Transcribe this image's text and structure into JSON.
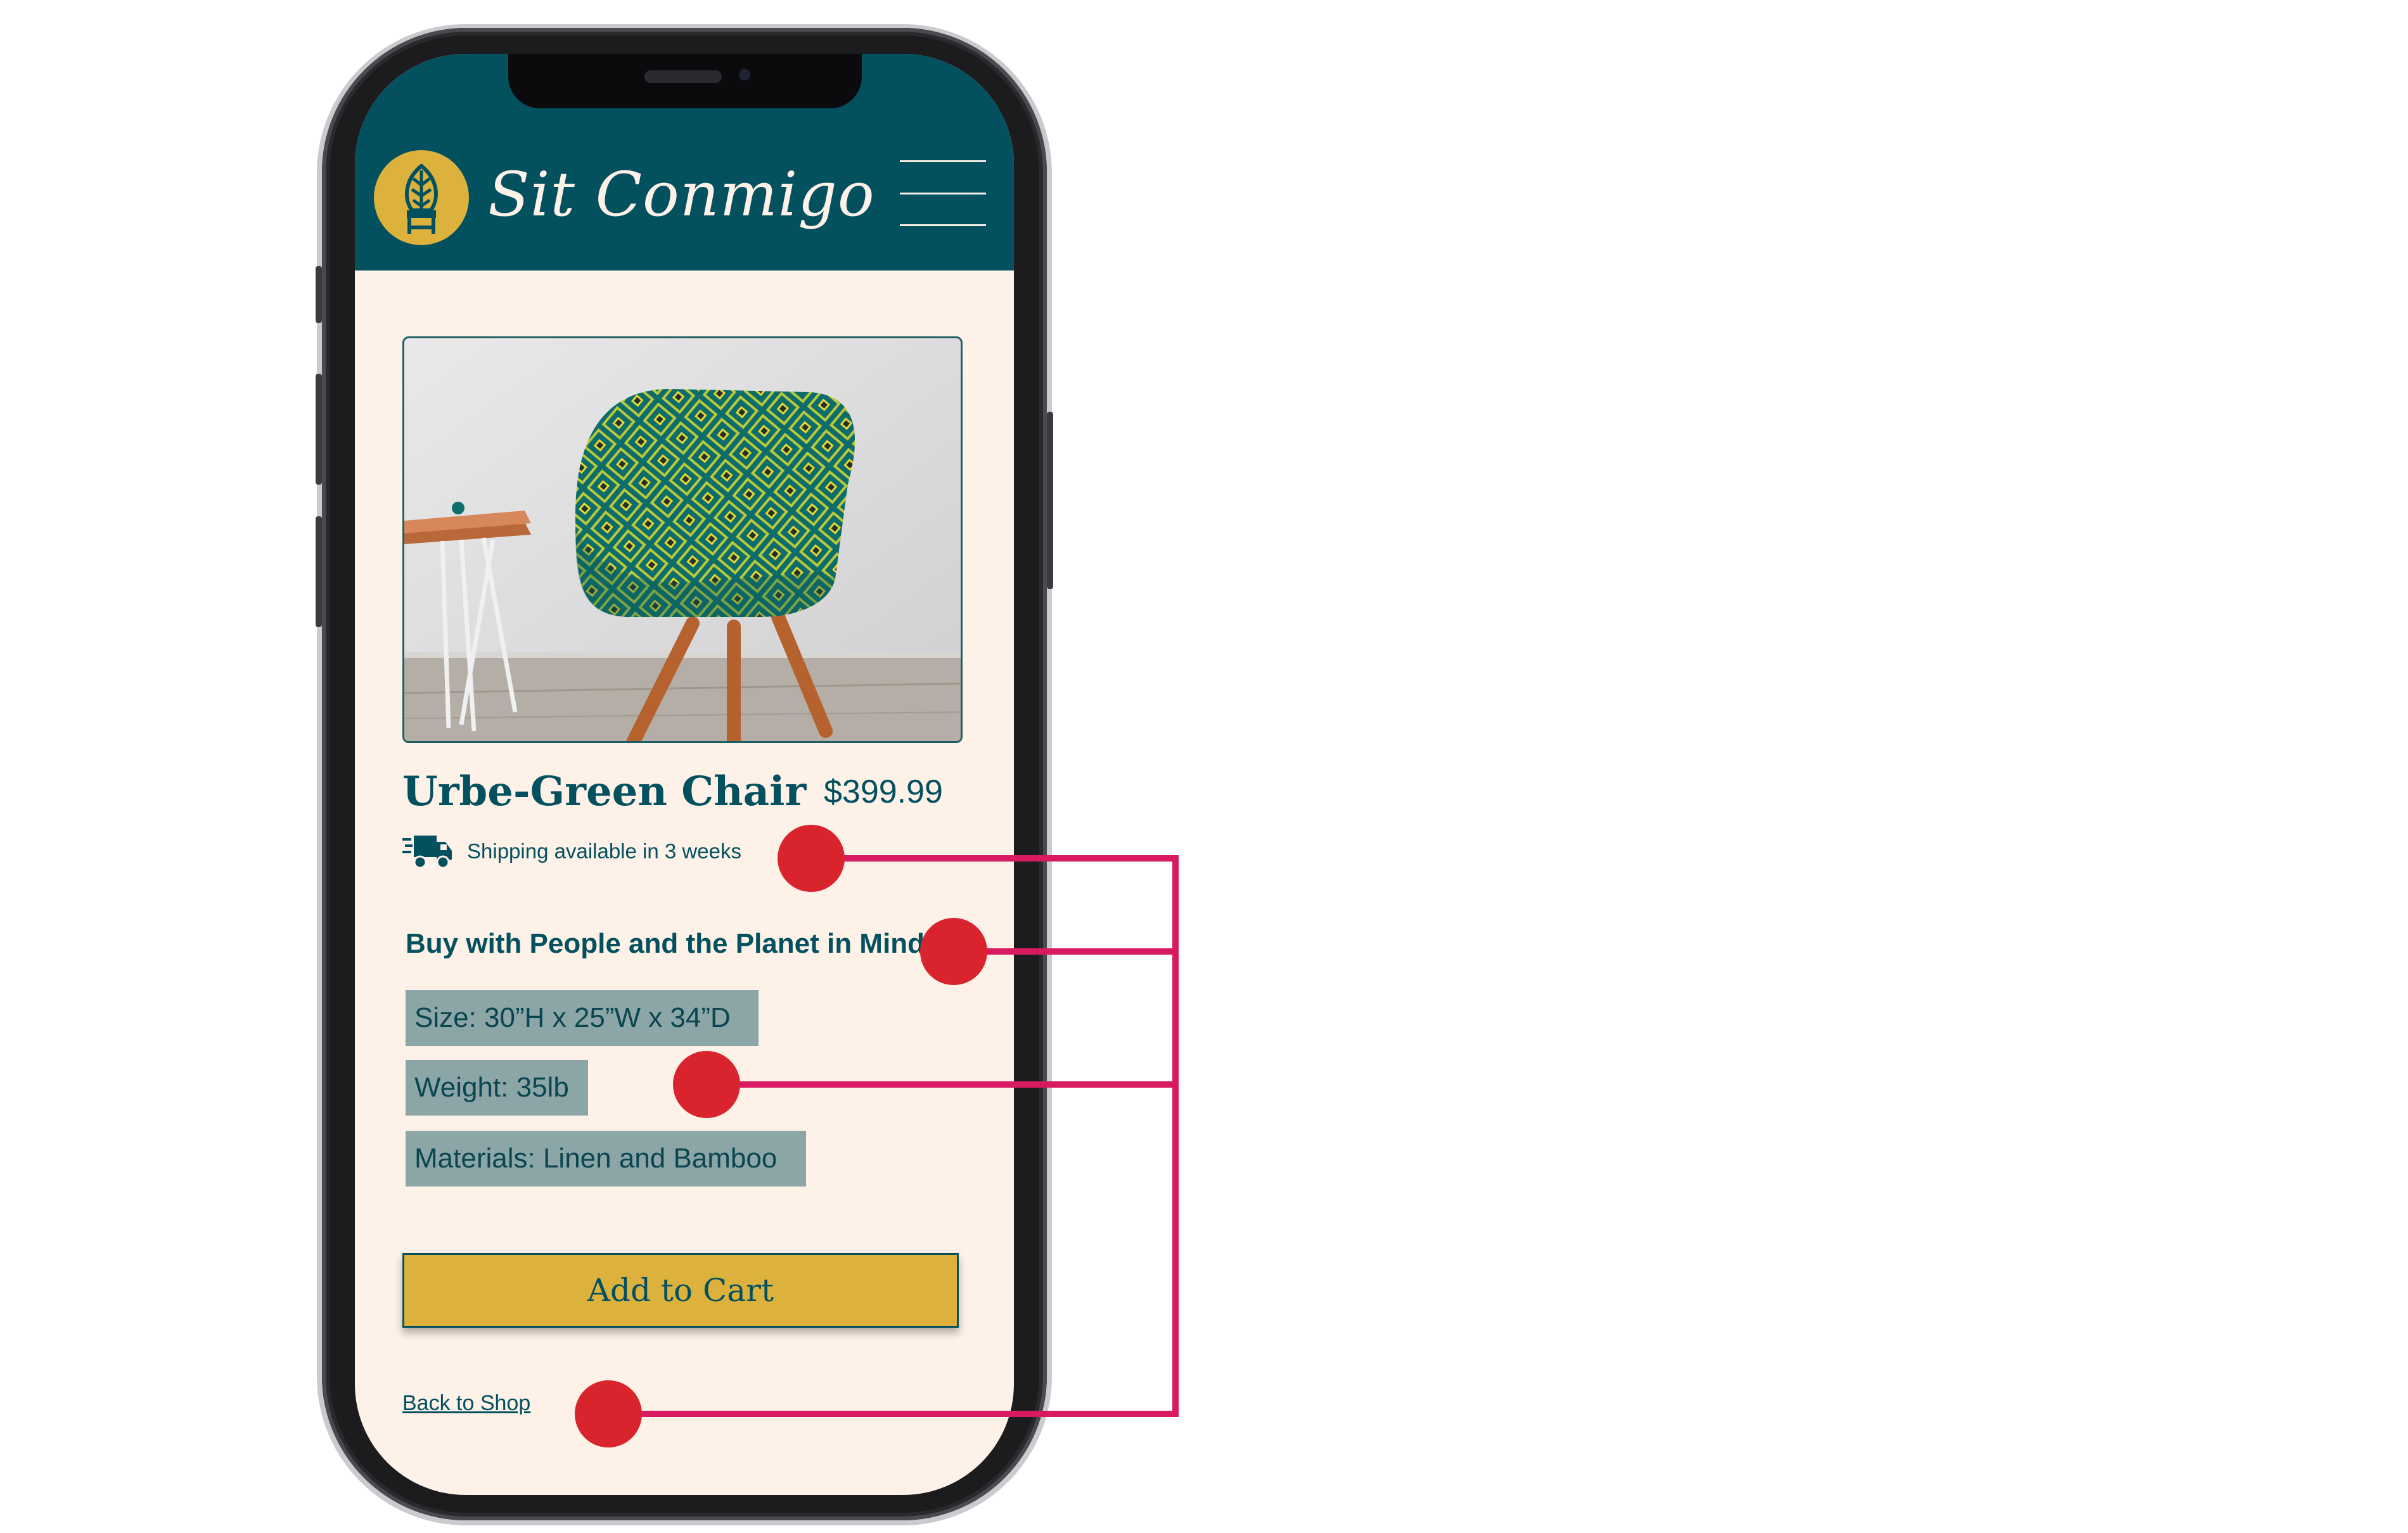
{
  "app": {
    "brand_name": "Sit Conmigo",
    "header_color": "#03505f",
    "accent_color": "#dcb23d",
    "background_color": "#fdf1e8"
  },
  "header": {
    "logo_icon": "chair-leaf-logo-icon",
    "menu_icon": "hamburger-menu-icon"
  },
  "product": {
    "image_icon": "chair-photo",
    "title": "Urbe-Green Chair",
    "price": "$399.99",
    "shipping_icon": "truck-icon",
    "shipping": "Shipping available in 3 weeks",
    "headline": "Buy with People and the Planet in Mind",
    "specs": [
      "Size: 30”H  x  25”W  x  34”D",
      "Weight: 35lb",
      "Materials: Linen and Bamboo"
    ]
  },
  "actions": {
    "add_to_cart": "Add to Cart",
    "back_to_shop": "Back to Shop"
  },
  "annotation": {
    "marker_color": "#d9242d",
    "line_color": "#d81b60"
  }
}
